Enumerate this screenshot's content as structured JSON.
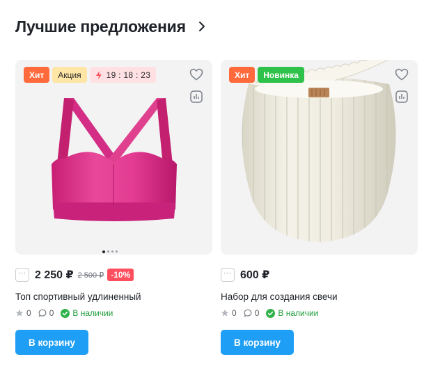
{
  "section": {
    "title": "Лучшие предложения",
    "chevron_icon": "chevron-right-icon"
  },
  "colors": {
    "badge_hit": "#ff6a3d",
    "badge_promo": "#ffe6a6",
    "badge_new": "#2fc24a",
    "badge_timer": "#ffe1e3",
    "discount": "#ff4f5e",
    "cart_button": "#1e9ef5",
    "in_stock": "#1e9c3a"
  },
  "products": [
    {
      "badges": {
        "hit": "Хит",
        "promo": "Акция",
        "timer": "19 : 18 : 23"
      },
      "image": "pink-sports-bra",
      "price": "2 250 ₽",
      "old_price": "2 500 ₽",
      "discount": "-10%",
      "more_label": "···",
      "title": "Топ спортивный удлиненный",
      "rating_count": "0",
      "reviews_count": "0",
      "stock": "В наличии",
      "cart_label": "В корзину"
    },
    {
      "badges": {
        "hit": "Хит",
        "new": "Новинка"
      },
      "image": "ribbed-candle",
      "price": "600 ₽",
      "more_label": "···",
      "title": "Набор для создания свечи",
      "rating_count": "0",
      "reviews_count": "0",
      "stock": "В наличии",
      "cart_label": "В корзину"
    }
  ]
}
